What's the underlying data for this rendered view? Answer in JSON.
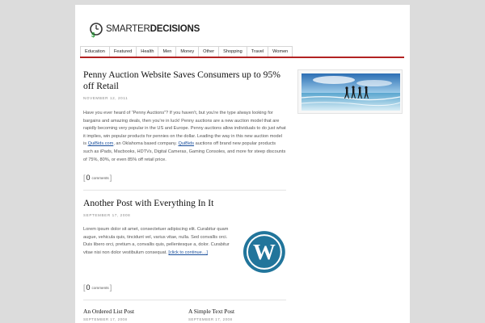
{
  "site": {
    "logo_light": "SMARTER",
    "logo_bold": "DECISIONS",
    "logo_icon": "clock-dollar-icon"
  },
  "nav": {
    "items": [
      {
        "label": "Education"
      },
      {
        "label": "Featured"
      },
      {
        "label": "Health"
      },
      {
        "label": "Men"
      },
      {
        "label": "Money"
      },
      {
        "label": "Other"
      },
      {
        "label": "Shopping"
      },
      {
        "label": "Travel"
      },
      {
        "label": "Women"
      }
    ],
    "accent_color": "#b22222"
  },
  "posts": [
    {
      "title": "Penny Auction Website Saves Consumers up to 95% off Retail",
      "date": "NOVEMBER 12, 2011",
      "body_1": "Have you ever heard of “Penny Auctions”? If you haven't, but you're the type always looking for bargains and amazing deals, then you're in luck! Penny auctions are   a new auction model that are rapidly becoming very popular in the US and Europe. Penny auctions allow individuals to do just what it implies, win popular products for pennies on the dollar. Leading the way in this new auction model is ",
      "link_1": "QuiBids.com",
      "body_2": ", an Oklahoma based company. ",
      "link_2": "QuiBids",
      "body_3": " auctions off brand new popular products such as iPads, Macbooks, HDTVs, Digital Cameras, Gaming Consoles, and more for    steep discounts of 75%, 80%, or even 85% off retail price.",
      "comments_count": "0",
      "comments_label": "comments"
    },
    {
      "title": "Another Post with Everything In It",
      "date": "SEPTEMBER 17, 2008",
      "body_1": "Lorem ipsum dolor sit amet, consectetuer adipiscing elit. Curabitur quam augue, vehicula quis, tincidunt vel, varius vitae, nulla. Sed convallis orci. Duis libero orci, pretium a, ",
      "link_1": "convallis quis",
      "body_2": ", pellentesque a, dolor. Curabitur vitae nisi non dolor vestibulum consequat. ",
      "more_link": "[click to continue…]",
      "thumbnail_icon": "wordpress-logo-icon",
      "comments_count": "0",
      "comments_label": "comments"
    }
  ],
  "mini_posts": [
    {
      "title": "An Ordered List Post",
      "date": "SEPTEMBER 17, 2008"
    },
    {
      "title": "A Simple Text Post",
      "date": "SEPTEMBER 17, 2008"
    }
  ],
  "sidebar": {
    "image_icon": "beach-runners-photo"
  }
}
